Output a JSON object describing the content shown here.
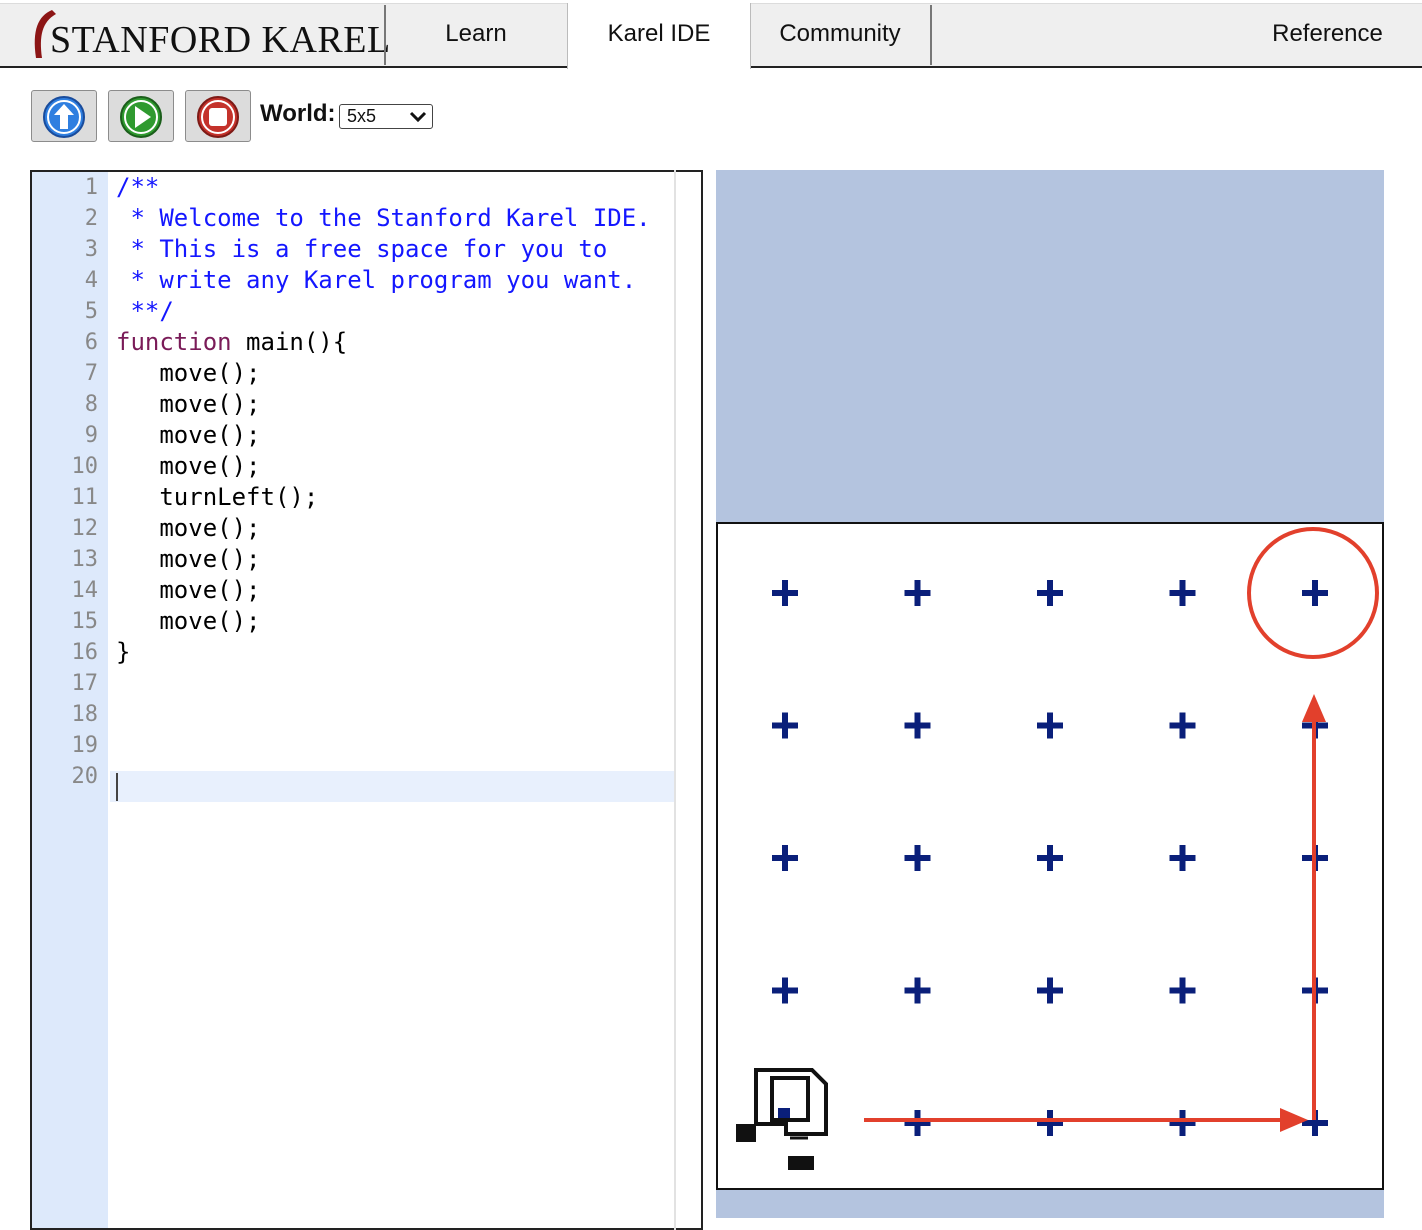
{
  "nav": {
    "logo_text": "STANFORD KAREL",
    "tabs": [
      {
        "label": "Learn"
      },
      {
        "label": "Karel IDE"
      },
      {
        "label": "Community"
      },
      {
        "label": "Reference"
      }
    ],
    "active_tab": "Karel IDE"
  },
  "toolbar": {
    "buttons": [
      {
        "name": "upload",
        "icon": "up-arrow-icon",
        "color": "#2f7fe0"
      },
      {
        "name": "run",
        "icon": "play-icon",
        "color": "#2f9a2f"
      },
      {
        "name": "stop",
        "icon": "stop-icon",
        "color": "#c4322b"
      }
    ],
    "world_label": "World:",
    "world_value": "5x5"
  },
  "editor": {
    "line_numbers": [
      "1",
      "2",
      "3",
      "4",
      "5",
      "6",
      "7",
      "8",
      "9",
      "10",
      "11",
      "12",
      "13",
      "14",
      "15",
      "16",
      "17",
      "18",
      "19",
      "20"
    ],
    "lines": [
      "/**",
      " * Welcome to the Stanford Karel IDE.",
      " * This is a free space for you to",
      " * write any Karel program you want.",
      " **/",
      "function main(){",
      "   move();",
      "   move();",
      "   move();",
      "   move();",
      "   turnLeft();",
      "   move();",
      "   move();",
      "   move();",
      "   move();",
      "}",
      "",
      "",
      "",
      ""
    ],
    "active_line": 20,
    "colors": {
      "comment": "#1417ff",
      "keyword": "#7a1b58",
      "gutter": "#dde9fb"
    }
  },
  "world": {
    "rows": 5,
    "cols": 5,
    "karel": {
      "avenue": 1,
      "street": 1,
      "facing": "east"
    },
    "background": "#b4c4df",
    "corner_color": "#0a1f7a",
    "annotation": {
      "color": "#e2402c",
      "path": "right along street 1 to avenue 5, then up along avenue 5 toward street 4",
      "circled_corner": {
        "avenue": 5,
        "street": 5
      }
    }
  }
}
